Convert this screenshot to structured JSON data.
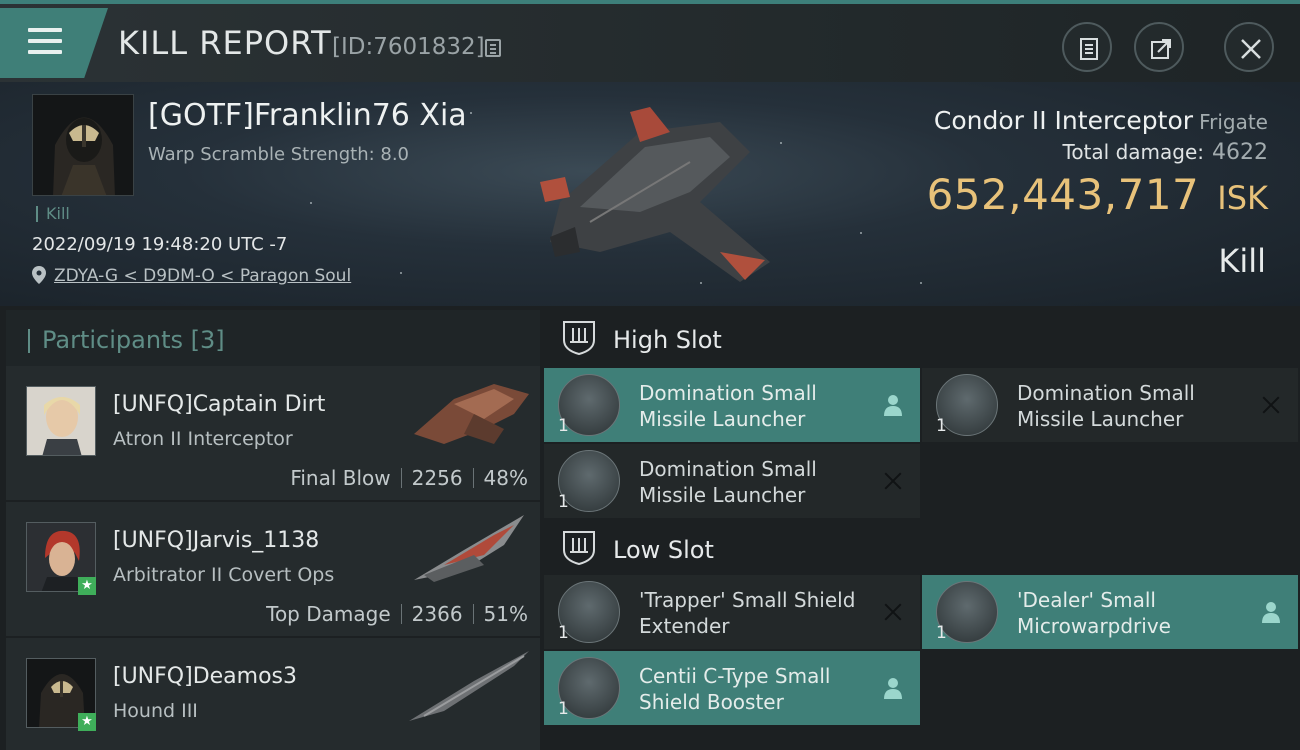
{
  "header": {
    "title": "KILL REPORT",
    "report_id": "[ID:7601832]"
  },
  "victim": {
    "name": "[GOTF]Franklin76 Xia",
    "warp_scramble": "Warp Scramble Strength: 8.0",
    "tag": "Kill",
    "datetime": "2022/09/19 19:48:20 UTC -7",
    "location": "ZDYA-G < D9DM-O < Paragon Soul",
    "ship_name": "Condor II Interceptor",
    "ship_class": "Frigate",
    "total_damage_label": "Total damage:",
    "total_damage_value": "4622",
    "isk_value": "652,443,717",
    "isk_unit": "ISK",
    "result": "Kill"
  },
  "participants": {
    "label": "Participants",
    "count": "[3]",
    "items": [
      {
        "name": "[UNFQ]Captain Dirt",
        "ship": "Atron II Interceptor",
        "role": "Final Blow",
        "damage": "2256",
        "percent": "48%"
      },
      {
        "name": "[UNFQ]Jarvis_1138",
        "ship": "Arbitrator II Covert Ops",
        "role": "Top Damage",
        "damage": "2366",
        "percent": "51%"
      },
      {
        "name": "[UNFQ]Deamos3",
        "ship": "Hound III"
      }
    ]
  },
  "slots": {
    "high": {
      "label": "High Slot",
      "items": [
        {
          "name_line1": "Domination Small",
          "name_line2": "Missile Launcher",
          "qty": "1"
        },
        {
          "name_line1": "Domination Small",
          "name_line2": "Missile Launcher",
          "qty": "1"
        },
        {
          "name_line1": "Domination Small",
          "name_line2": "Missile Launcher",
          "qty": "1"
        }
      ]
    },
    "low": {
      "label": "Low Slot",
      "items": [
        {
          "name_line1": "'Trapper' Small Shield",
          "name_line2": "Extender",
          "qty": "1"
        },
        {
          "name_line1": "'Dealer' Small",
          "name_line2": "Microwarpdrive",
          "qty": "1"
        },
        {
          "name_line1": "Centii C-Type Small",
          "name_line2": "Shield Booster",
          "qty": "1"
        }
      ]
    }
  },
  "colors": {
    "accent": "#3f7f78",
    "isk": "#e8c27a"
  }
}
